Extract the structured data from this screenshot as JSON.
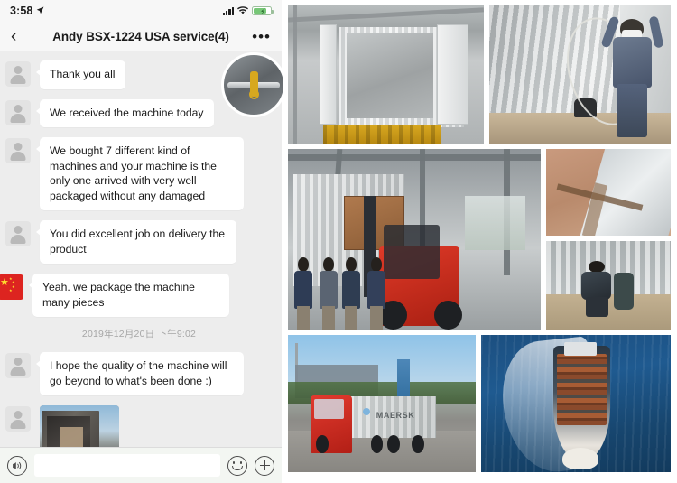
{
  "status_bar": {
    "time": "3:58",
    "location_icon": "location-arrow-icon",
    "signal_icon": "cellular-signal-icon",
    "wifi_icon": "wifi-icon",
    "battery_icon": "battery-charging-icon"
  },
  "header": {
    "back_icon": "back-chevron-icon",
    "title": "Andy BSX-1224 USA service(4)",
    "more_icon": "more-options-icon"
  },
  "messages": [
    {
      "avatar": "generic",
      "type": "text",
      "text": "Thank you all"
    },
    {
      "avatar": "generic",
      "type": "text",
      "text": "We received the machine today"
    },
    {
      "avatar": "generic",
      "type": "text",
      "text": "We bought 7 different kind of machines and your machine is the only one arrived with very well packaged without any damaged"
    },
    {
      "avatar": "generic",
      "type": "text",
      "text": "You did excellent job on delivery the product"
    },
    {
      "avatar": "flag",
      "type": "text",
      "text": "Yeah. we package the machine many pieces"
    }
  ],
  "timestamp": "2019年12月20日 下午9:02",
  "messages_after": [
    {
      "avatar": "generic",
      "type": "text",
      "text": "I hope the quality of the machine will go beyond to what's been done :)"
    },
    {
      "avatar": "generic",
      "type": "photo",
      "alt": "truck-container-with-crate-photo"
    }
  ],
  "input_bar": {
    "voice_icon": "voice-input-icon",
    "input_value": "",
    "input_placeholder": "",
    "emoji_icon": "emoji-icon",
    "plus_icon": "add-attachment-icon"
  },
  "collage": {
    "tiles": [
      {
        "id": "empty-container-interior",
        "caption": "Empty shipping container interior in warehouse"
      },
      {
        "id": "worker-with-cable-in-container",
        "caption": "Worker holding steel cable inside container"
      },
      {
        "id": "forklift-loading-crate",
        "caption": "Forklift loading wooden crate into container with workers"
      },
      {
        "id": "lashing-hardware-closeup",
        "caption": "Close-up of lashing turnbuckle hardware"
      },
      {
        "id": "container-corner-detail",
        "caption": "Container corner and wooden floor detail"
      },
      {
        "id": "worker-securing-floor",
        "caption": "Worker crouching securing cargo on container floor"
      },
      {
        "id": "truck-with-maersk-container",
        "caption": "Red truck hauling MAERSK container"
      },
      {
        "id": "container-ship-aerial",
        "caption": "Aerial view of container ship at sea"
      }
    ],
    "maersk_label": "MAERSK"
  },
  "colors": {
    "chat_bg": "#ededed",
    "bubble_bg": "#ffffff",
    "header_bg": "#f7f7f7",
    "flag_red": "#dd2420",
    "flag_yellow": "#ffde2e",
    "battery_green": "#77c777",
    "truck_red": "#e23a2e"
  }
}
